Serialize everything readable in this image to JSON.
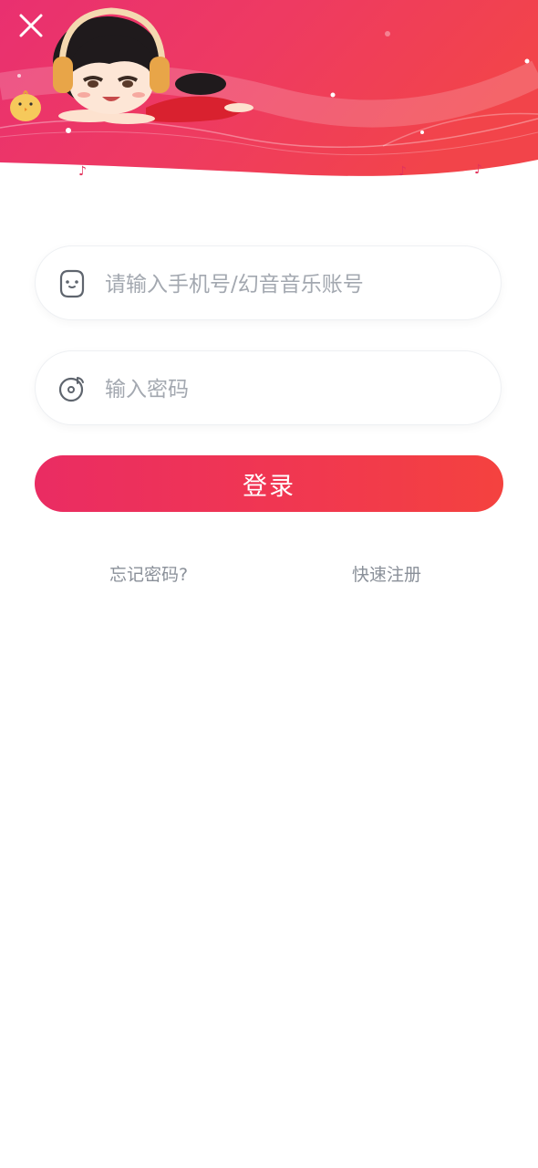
{
  "login": {
    "phone_placeholder": "请输入手机号/幻音音乐账号",
    "password_placeholder": "输入密码",
    "submit_label": "登录",
    "forgot_label": "忘记密码?",
    "register_label": "快速注册"
  },
  "icons": {
    "close": "close-icon",
    "phone": "face-icon",
    "password": "music-disc-icon"
  },
  "colors": {
    "accent_start": "#ea2c63",
    "accent_end": "#f4423f",
    "link": "#8a9099",
    "placeholder": "#a3a8b0"
  }
}
